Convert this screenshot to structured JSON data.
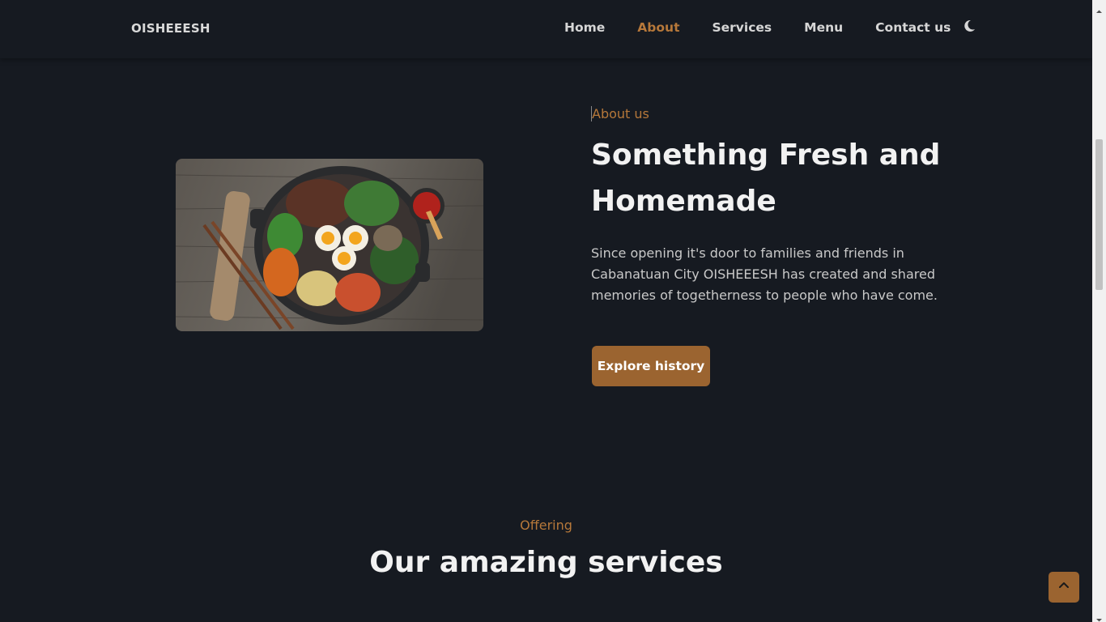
{
  "header": {
    "logo": "OISHEEESH",
    "nav": [
      {
        "label": "Home",
        "active": false
      },
      {
        "label": "About",
        "active": true
      },
      {
        "label": "Services",
        "active": false
      },
      {
        "label": "Menu",
        "active": false
      },
      {
        "label": "Contact us",
        "active": false
      }
    ],
    "theme_icon": "moon-icon"
  },
  "about": {
    "subtitle": "About us",
    "title": "Something Fresh and Homemade",
    "description": "Since opening it's door to families and friends in Cabanatuan City OISHEEESH has created and shared memories of togetherness to people who have come.",
    "button_label": "Explore history",
    "image_icon": "food-bowl-image"
  },
  "services": {
    "subtitle": "Offering",
    "title": "Our amazing services"
  },
  "scroll_up_icon": "chevron-up-icon",
  "colors": {
    "background": "#161a21",
    "accent": "#b6783a",
    "button": "#9b6430"
  }
}
